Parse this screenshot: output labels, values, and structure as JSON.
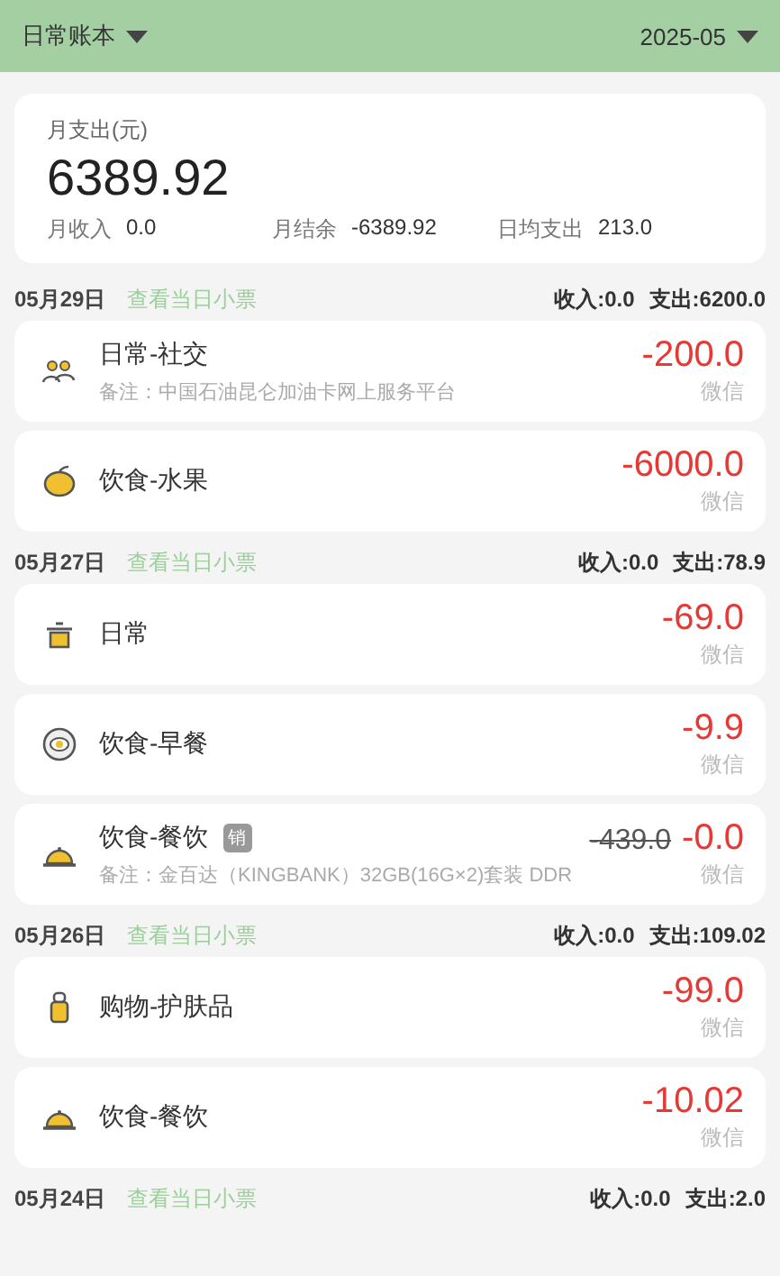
{
  "header": {
    "book": "日常账本",
    "month": "2025-05"
  },
  "summary": {
    "label": "月支出(元)",
    "total": "6389.92",
    "stats": [
      {
        "label": "月收入",
        "value": "0.0"
      },
      {
        "label": "月结余",
        "value": "-6389.92"
      },
      {
        "label": "日均支出",
        "value": "213.0"
      }
    ]
  },
  "days": [
    {
      "date": "05月29日",
      "link": "查看当日小票",
      "income": "收入:0.0",
      "expense": "支出:6200.0",
      "entries": [
        {
          "kind": "people",
          "title": "日常-社交",
          "note": "备注：中国石油昆仑加油卡网上服务平台",
          "amount": "-200.0",
          "account": "微信"
        },
        {
          "kind": "fruit",
          "title": "饮食-水果",
          "amount": "-6000.0",
          "account": "微信"
        }
      ]
    },
    {
      "date": "05月27日",
      "link": "查看当日小票",
      "income": "收入:0.0",
      "expense": "支出:78.9",
      "entries": [
        {
          "kind": "pot",
          "title": "日常",
          "amount": "-69.0",
          "account": "微信"
        },
        {
          "kind": "plate",
          "title": "饮食-早餐",
          "amount": "-9.9",
          "account": "微信"
        },
        {
          "kind": "cloche",
          "title": "饮食-餐饮",
          "badge": "销",
          "note": "备注：金百达（KINGBANK）32GB(16G×2)套装 DDR",
          "original": "-439.0",
          "amount": "-0.0",
          "account": "微信"
        }
      ]
    },
    {
      "date": "05月26日",
      "link": "查看当日小票",
      "income": "收入:0.0",
      "expense": "支出:109.02",
      "entries": [
        {
          "kind": "bottle",
          "title": "购物-护肤品",
          "amount": "-99.0",
          "account": "微信"
        },
        {
          "kind": "cloche",
          "title": "饮食-餐饮",
          "amount": "-10.02",
          "account": "微信"
        }
      ]
    },
    {
      "date": "05月24日",
      "link": "查看当日小票",
      "income": "收入:0.0",
      "expense": "支出:2.0"
    }
  ]
}
